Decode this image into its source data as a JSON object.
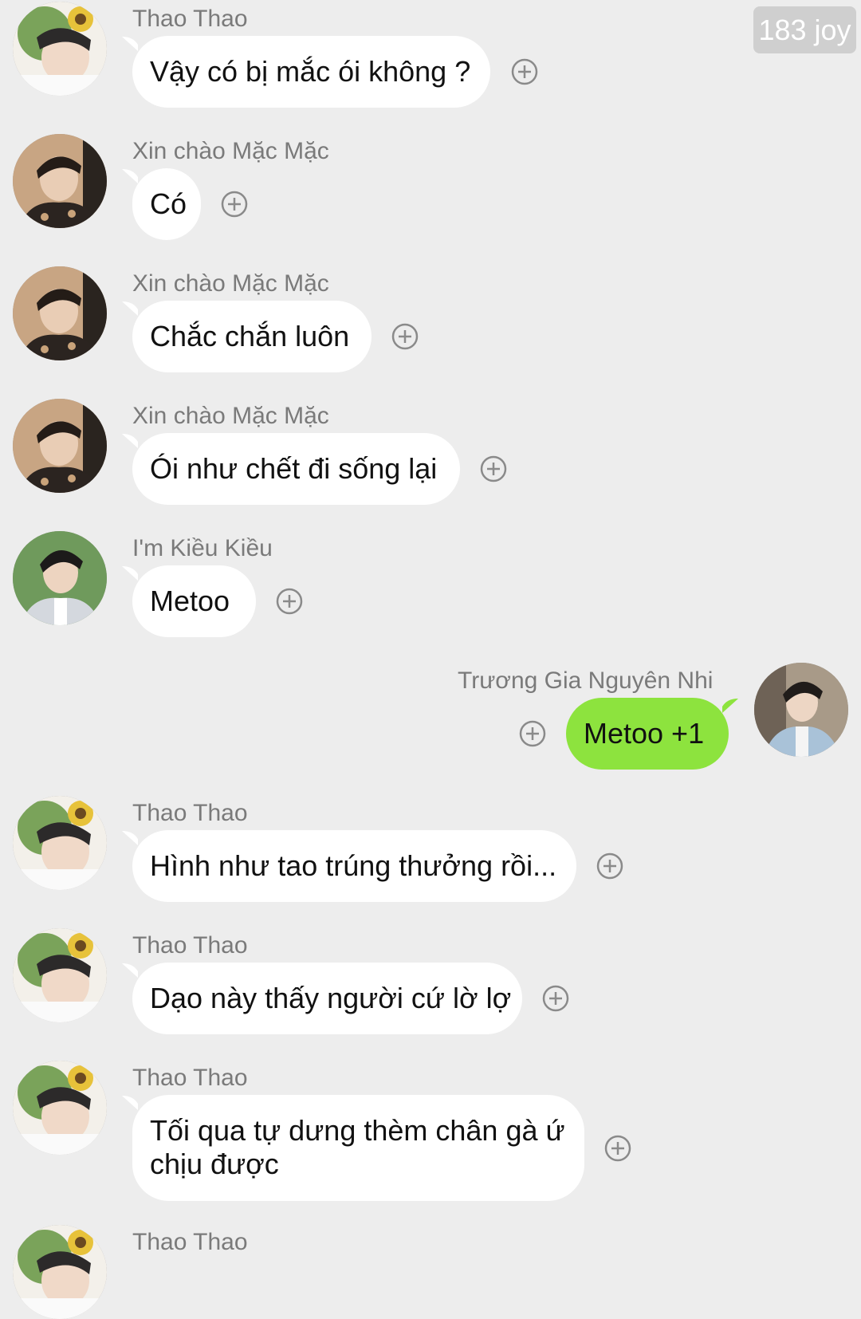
{
  "badge": {
    "text": "183 joy"
  },
  "messages": [
    {
      "sender": "Thao Thao",
      "text": "Vậy có bị mắc ói không ?",
      "avatar_icon": "avatar-sunflower-icon"
    },
    {
      "sender": "Xin chào Mặc Mặc",
      "text": "Có",
      "avatar_icon": "avatar-portrait-icon"
    },
    {
      "sender": "Xin chào Mặc Mặc",
      "text": "Chắc chắn luôn",
      "avatar_icon": "avatar-portrait-icon"
    },
    {
      "sender": "Xin chào Mặc Mặc",
      "text": "Ói như chết đi sống lại",
      "avatar_icon": "avatar-portrait-icon"
    },
    {
      "sender": "I'm Kiều Kiều",
      "text": "Metoo",
      "avatar_icon": "avatar-suit-icon"
    },
    {
      "sender": "Trương Gia Nguyên Nhi",
      "text": "Metoo +1",
      "avatar_icon": "avatar-blue-suit-icon",
      "own": true
    },
    {
      "sender": "Thao Thao",
      "text": "Hình như tao trúng thưởng rồi...",
      "avatar_icon": "avatar-sunflower-icon"
    },
    {
      "sender": "Thao Thao",
      "text": "Dạo này thấy người cứ lờ lợ",
      "avatar_icon": "avatar-sunflower-icon"
    },
    {
      "sender": "Thao Thao",
      "text": "Tối qua tự dưng thèm chân gà ứ chịu được",
      "avatar_icon": "avatar-sunflower-icon"
    },
    {
      "sender": "Thao Thao",
      "text": "",
      "avatar_icon": "avatar-sunflower-icon"
    }
  ],
  "colors": {
    "background": "#ededed",
    "bubble_other": "#ffffff",
    "bubble_own": "#8de33e",
    "sender_text": "#7a7a7a"
  },
  "icons": {
    "react": "plus-circle-icon"
  }
}
